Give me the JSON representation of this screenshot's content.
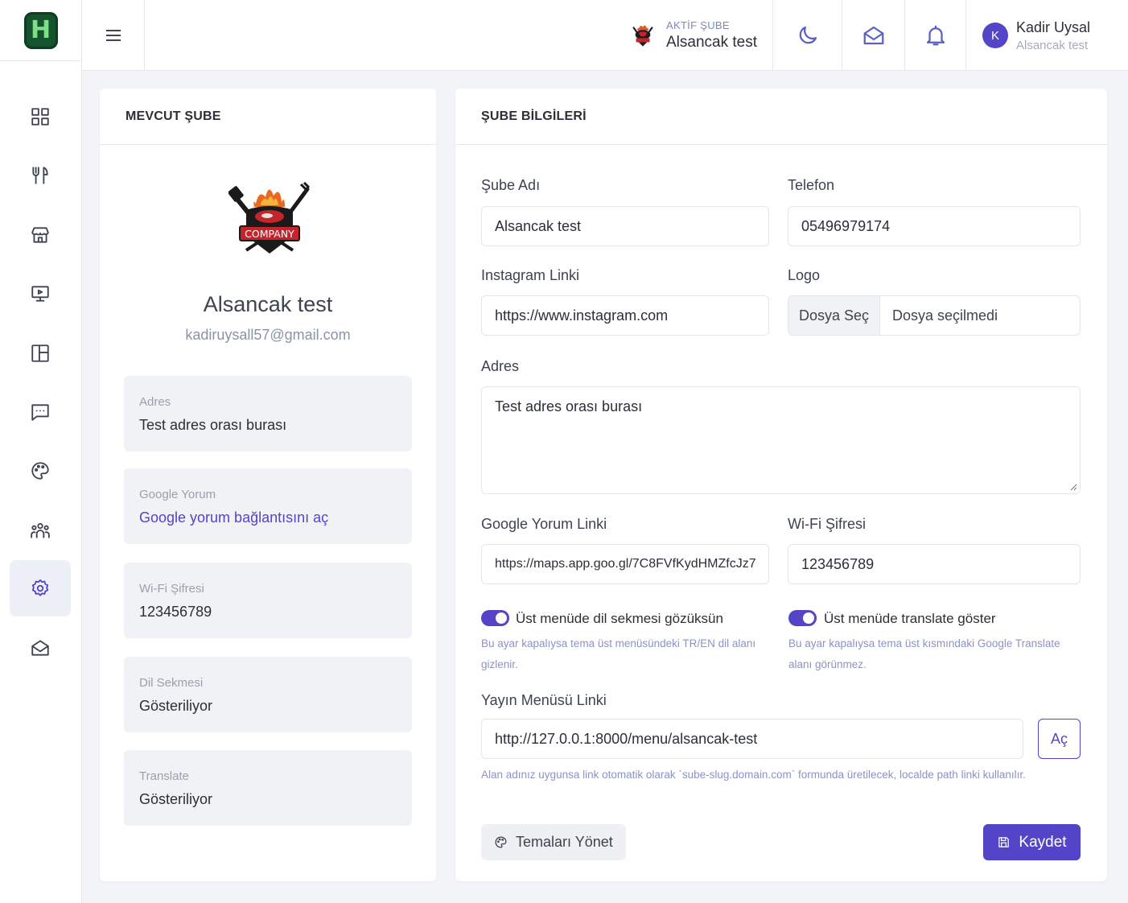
{
  "app": {
    "logo_letter": "H"
  },
  "sidebar": {
    "items": [
      {
        "name": "grid",
        "icon": "dashboard-grid-icon"
      },
      {
        "name": "menu",
        "icon": "fork-knife-icon"
      },
      {
        "name": "store",
        "icon": "store-icon"
      },
      {
        "name": "screen",
        "icon": "monitor-icon"
      },
      {
        "name": "layout",
        "icon": "layout-icon"
      },
      {
        "name": "messages",
        "icon": "chat-icon"
      },
      {
        "name": "themes",
        "icon": "palette-icon"
      },
      {
        "name": "users",
        "icon": "users-icon"
      },
      {
        "name": "settings",
        "icon": "gear-icon",
        "active": true
      },
      {
        "name": "mail",
        "icon": "mail-open-icon"
      }
    ]
  },
  "header": {
    "branch_label": "AKTİF ŞUBE",
    "branch_name": "Alsancak test",
    "user_initial": "K",
    "user_name": "Kadir Uysal",
    "user_branch": "Alsancak test"
  },
  "left_card": {
    "title": "MEVCUT ŞUBE",
    "logo_text": "COMPANY",
    "name": "Alsancak test",
    "email": "kadiruysall57@gmail.com",
    "info": [
      {
        "label": "Adres",
        "value": "Test adres orası burası",
        "type": "text"
      },
      {
        "label": "Google Yorum",
        "value": "Google yorum bağlantısını aç",
        "type": "link"
      },
      {
        "label": "Wi-Fi Şifresi",
        "value": "123456789",
        "type": "text"
      },
      {
        "label": "Dil Sekmesi",
        "value": "Gösteriliyor",
        "type": "text"
      },
      {
        "label": "Translate",
        "value": "Gösteriliyor",
        "type": "text"
      }
    ]
  },
  "form": {
    "title": "ŞUBE BİLGİLERİ",
    "branch_name_label": "Şube Adı",
    "branch_name_value": "Alsancak test",
    "phone_label": "Telefon",
    "phone_value": "05496979174",
    "instagram_label": "Instagram Linki",
    "instagram_value": "https://www.instagram.com",
    "logo_label": "Logo",
    "file_button": "Dosya Seç",
    "file_status": "Dosya seçilmedi",
    "address_label": "Adres",
    "address_value": "Test adres orası burası",
    "google_label": "Google Yorum Linki",
    "google_value": "https://maps.app.goo.gl/7C8FVfKydHMZfcJz7",
    "wifi_label": "Wi-Fi Şifresi",
    "wifi_value": "123456789",
    "toggle_lang_label": "Üst menüde dil sekmesi gözüksün",
    "toggle_lang_on": true,
    "toggle_lang_hint": "Bu ayar kapalıysa tema üst menüsündeki TR/EN dil alanı gizlenir.",
    "toggle_translate_label": "Üst menüde translate göster",
    "toggle_translate_on": true,
    "toggle_translate_hint": "Bu ayar kapalıysa tema üst kısmındaki Google Translate alanı görünmez.",
    "menu_link_label": "Yayın Menüsü Linki",
    "menu_link_value": "http://127.0.0.1:8000/menu/alsancak-test",
    "open_button": "Aç",
    "menu_link_hint": "Alan adınız uygunsa link otomatik olarak `sube-slug.domain.com` formunda üretilecek, localde path linki kullanılır.",
    "themes_button": "Temaları Yönet",
    "save_button": "Kaydet"
  },
  "colors": {
    "accent": "#5344c8",
    "logo_bg": "#14532d",
    "logo_fg": "#7ee084"
  }
}
